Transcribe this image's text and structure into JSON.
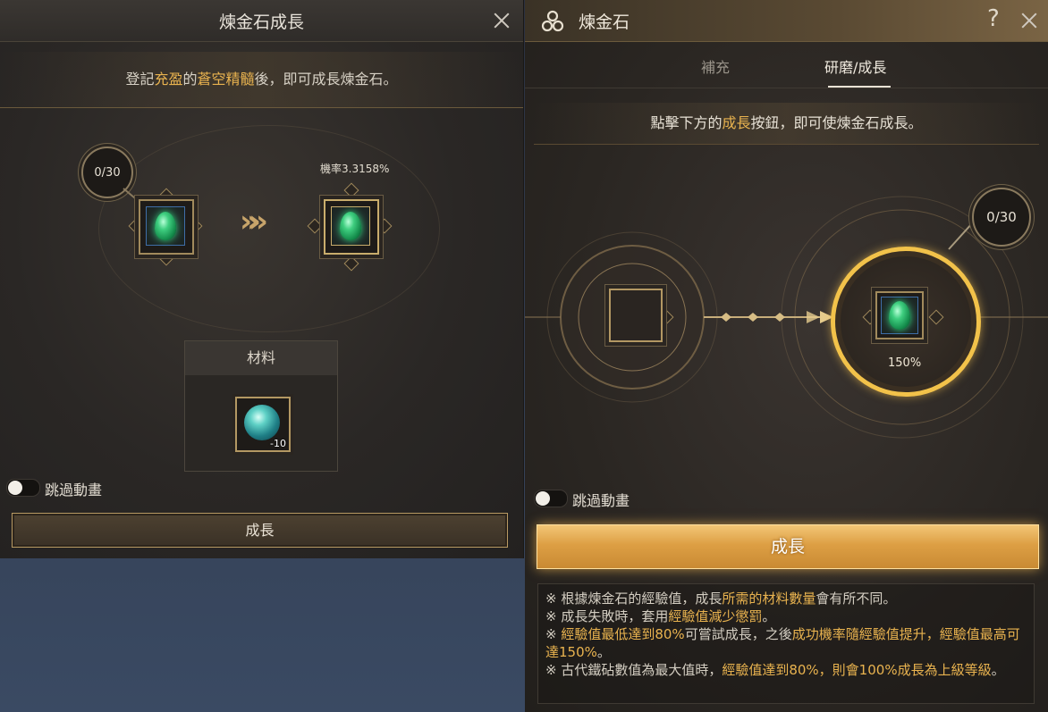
{
  "left_panel": {
    "title": "煉金石成長",
    "notice": {
      "before": "登記",
      "hl1": "充盈",
      "mid": "的",
      "hl2": "蒼空精髓",
      "after": "後，即可成長煉金石。"
    },
    "progress": "0/30",
    "probability": "機率3.3158%",
    "arrows": "»»",
    "material_header": "材料",
    "material_qty": "-10",
    "skip_label": "跳過動畫",
    "grow_button": "成長"
  },
  "right_panel": {
    "title": "煉金石",
    "help": "?",
    "tabs": [
      "補充",
      "研磨/成長"
    ],
    "active_tab_index": 1,
    "notice": {
      "before": "點擊下方的",
      "hl": "成長",
      "after": "按鈕，即可使煉金石成長。"
    },
    "progress": "0/30",
    "percent": "150%",
    "skip_label": "跳過動畫",
    "grow_button": "成長",
    "notes": [
      {
        "prefix": "※ 根據煉金石的經驗值，成長",
        "hl": "所需的材料數量",
        "suffix": "會有所不同。"
      },
      {
        "prefix": "※ 成長失敗時，套用",
        "hl": "經驗值減少懲罰",
        "suffix": "。"
      },
      {
        "prefix": "※ ",
        "hl": "經驗值最低達到80%",
        "mid": "可嘗試成長，之後",
        "hl2": "成功機率隨經驗值提升，經驗值最高可達150%",
        "suffix": "。"
      },
      {
        "prefix": "※ 古代鐵砧數值為最大值時，",
        "hl": "經驗值達到80%，則會100%成長為上級等級",
        "suffix": "。"
      }
    ]
  },
  "colors": {
    "highlight": "#e9b34f",
    "button_gold": "#dd9f44"
  },
  "icons": [
    "close-icon",
    "help-icon",
    "triskele-icon",
    "gem-icon",
    "material-orb-icon"
  ]
}
